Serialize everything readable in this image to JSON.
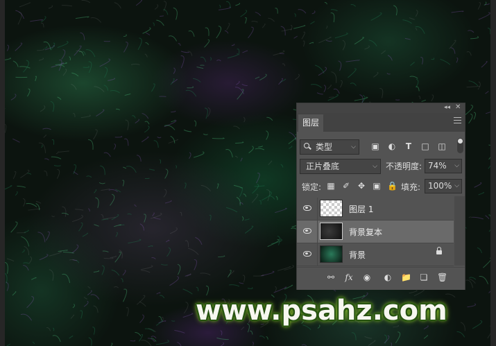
{
  "panel": {
    "tab_label": "图层",
    "collapse_glyph": "◂◂",
    "close_glyph": "✕",
    "filter": {
      "label": "类型",
      "icons": [
        "image-filter-icon",
        "adjustment-filter-icon",
        "type-filter-icon",
        "shape-filter-icon",
        "smart-object-filter-icon"
      ]
    },
    "blend_mode": "正片叠底",
    "opacity_label": "不透明度:",
    "opacity_value": "74%",
    "lock_label": "锁定:",
    "fill_label": "填充:",
    "fill_value": "100%",
    "layers": [
      {
        "name": "图层 1",
        "thumbnail": "transparent",
        "selected": false,
        "locked": false
      },
      {
        "name": "背景复本",
        "thumbnail": "dark-texture",
        "selected": true,
        "locked": false
      },
      {
        "name": "背景",
        "thumbnail": "green-texture",
        "selected": false,
        "locked": true
      }
    ],
    "bottom_icons": [
      "link-layers-icon",
      "fx-icon",
      "add-mask-icon",
      "adjustment-layer-icon",
      "new-group-icon",
      "new-layer-icon",
      "delete-icon"
    ],
    "fx_label": "fx"
  },
  "watermark": "www.psahz.com",
  "colors": {
    "panel_bg": "#535353",
    "selected_row": "#6a6a6a",
    "watermark_glow": "#9fdc2f"
  }
}
